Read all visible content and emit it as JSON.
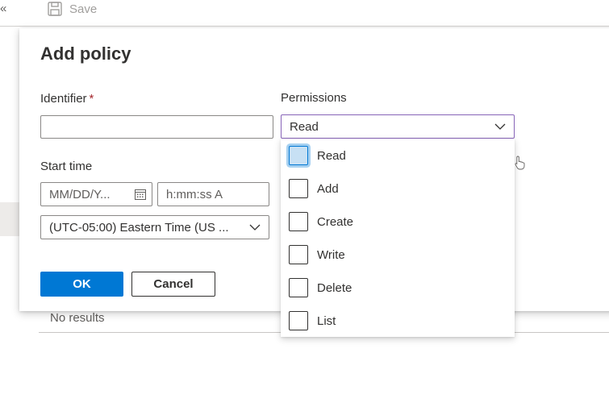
{
  "toolbar": {
    "collapse_glyph": "«",
    "save_label": "Save"
  },
  "background": {
    "no_results": "No results"
  },
  "dialog": {
    "title": "Add policy",
    "identifier_label": "Identifier",
    "required_marker": "*",
    "identifier_value": "",
    "permissions_label": "Permissions",
    "permissions_selected": "Read",
    "start_time_label": "Start time",
    "date_placeholder": "MM/DD/Y...",
    "time_placeholder": "h:mm:ss A",
    "timezone_value": "(UTC-05:00) Eastern Time (US ...",
    "ok_label": "OK",
    "cancel_label": "Cancel"
  },
  "permissions_options": [
    {
      "label": "Read",
      "checked": false,
      "focused": true
    },
    {
      "label": "Add",
      "checked": false,
      "focused": false
    },
    {
      "label": "Create",
      "checked": false,
      "focused": false
    },
    {
      "label": "Write",
      "checked": false,
      "focused": false
    },
    {
      "label": "Delete",
      "checked": false,
      "focused": false
    },
    {
      "label": "List",
      "checked": false,
      "focused": false
    }
  ],
  "colors": {
    "primary": "#0078d4",
    "select_border_active": "#8764b8",
    "required": "#a4262c"
  },
  "icons": [
    "double-chevron-left-icon",
    "save-icon",
    "chevron-down-icon",
    "calendar-icon",
    "mouse-cursor-icon"
  ]
}
